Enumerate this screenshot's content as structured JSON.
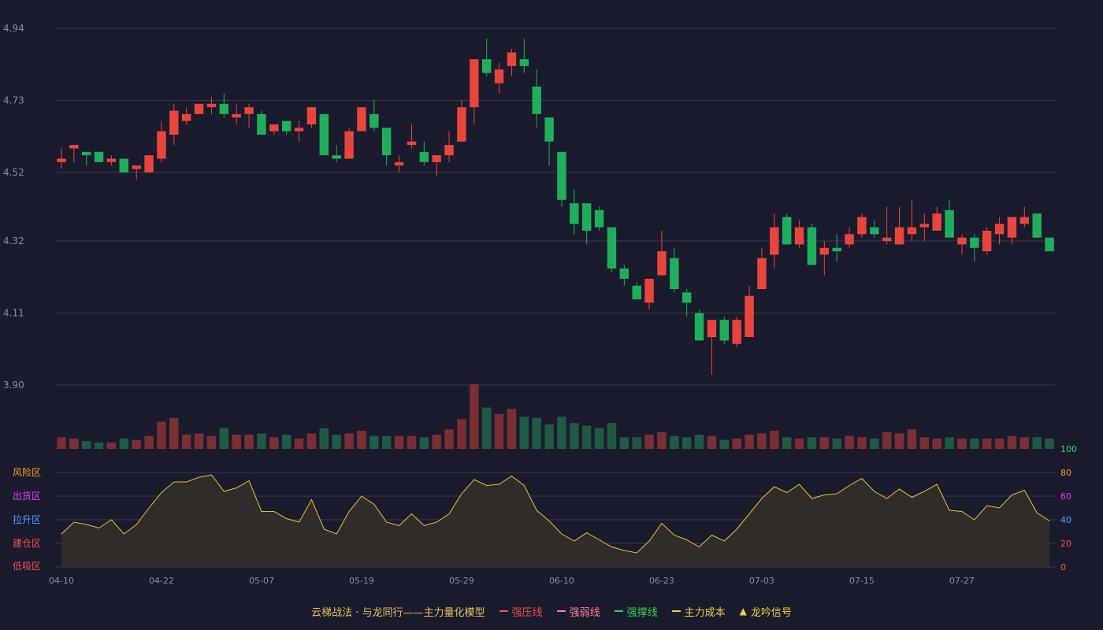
{
  "chart_data": {
    "type": "candlestick",
    "price_axis": {
      "ticks": [
        3.9,
        4.11,
        4.32,
        4.52,
        4.73,
        4.94
      ],
      "tick_labels": [
        "3.90",
        "4.11",
        "4.32",
        "4.52",
        "4.73",
        "4.94"
      ],
      "ylim": [
        3.9,
        4.94
      ]
    },
    "x_tick_labels": [
      "04-10",
      "04-22",
      "05-07",
      "05-19",
      "05-29",
      "06-10",
      "06-23",
      "07-03",
      "07-15",
      "07-27"
    ],
    "x_tick_indices": [
      0,
      8,
      16,
      24,
      32,
      40,
      48,
      56,
      64,
      72
    ],
    "candles": [
      [
        4.55,
        4.56,
        4.59,
        4.53
      ],
      [
        4.59,
        4.6,
        4.6,
        4.55
      ],
      [
        4.58,
        4.57,
        4.58,
        4.54
      ],
      [
        4.58,
        4.55,
        4.58,
        4.55
      ],
      [
        4.55,
        4.56,
        4.57,
        4.54
      ],
      [
        4.56,
        4.52,
        4.56,
        4.52
      ],
      [
        4.53,
        4.54,
        4.54,
        4.5
      ],
      [
        4.52,
        4.57,
        4.57,
        4.52
      ],
      [
        4.56,
        4.64,
        4.67,
        4.55
      ],
      [
        4.63,
        4.7,
        4.72,
        4.6
      ],
      [
        4.67,
        4.69,
        4.71,
        4.66
      ],
      [
        4.69,
        4.72,
        4.72,
        4.69
      ],
      [
        4.71,
        4.72,
        4.74,
        4.69
      ],
      [
        4.72,
        4.69,
        4.75,
        4.68
      ],
      [
        4.68,
        4.69,
        4.72,
        4.66
      ],
      [
        4.69,
        4.71,
        4.72,
        4.65
      ],
      [
        4.69,
        4.63,
        4.7,
        4.63
      ],
      [
        4.64,
        4.66,
        4.66,
        4.63
      ],
      [
        4.67,
        4.64,
        4.67,
        4.63
      ],
      [
        4.64,
        4.65,
        4.67,
        4.61
      ],
      [
        4.66,
        4.71,
        4.71,
        4.65
      ],
      [
        4.69,
        4.57,
        4.69,
        4.57
      ],
      [
        4.57,
        4.56,
        4.6,
        4.55
      ],
      [
        4.56,
        4.64,
        4.65,
        4.56
      ],
      [
        4.64,
        4.71,
        4.71,
        4.64
      ],
      [
        4.69,
        4.65,
        4.73,
        4.64
      ],
      [
        4.65,
        4.57,
        4.65,
        4.54
      ],
      [
        4.54,
        4.55,
        4.57,
        4.52
      ],
      [
        4.6,
        4.61,
        4.66,
        4.59
      ],
      [
        4.58,
        4.55,
        4.61,
        4.54
      ],
      [
        4.55,
        4.57,
        4.57,
        4.51
      ],
      [
        4.57,
        4.6,
        4.64,
        4.55
      ],
      [
        4.61,
        4.71,
        4.73,
        4.61
      ],
      [
        4.71,
        4.85,
        4.85,
        4.66
      ],
      [
        4.85,
        4.81,
        4.91,
        4.8
      ],
      [
        4.78,
        4.82,
        4.84,
        4.75
      ],
      [
        4.83,
        4.87,
        4.88,
        4.8
      ],
      [
        4.85,
        4.83,
        4.91,
        4.81
      ],
      [
        4.77,
        4.69,
        4.82,
        4.65
      ],
      [
        4.68,
        4.61,
        4.68,
        4.54
      ],
      [
        4.58,
        4.44,
        4.58,
        4.42
      ],
      [
        4.43,
        4.37,
        4.47,
        4.34
      ],
      [
        4.43,
        4.35,
        4.43,
        4.31
      ],
      [
        4.41,
        4.36,
        4.42,
        4.35
      ],
      [
        4.36,
        4.24,
        4.36,
        4.23
      ],
      [
        4.24,
        4.21,
        4.25,
        4.19
      ],
      [
        4.19,
        4.15,
        4.2,
        4.15
      ],
      [
        4.14,
        4.21,
        4.21,
        4.12
      ],
      [
        4.22,
        4.29,
        4.35,
        4.22
      ],
      [
        4.27,
        4.18,
        4.3,
        4.17
      ],
      [
        4.17,
        4.14,
        4.18,
        4.1
      ],
      [
        4.11,
        4.03,
        4.12,
        4.03
      ],
      [
        4.04,
        4.09,
        4.09,
        3.93
      ],
      [
        4.09,
        4.03,
        4.1,
        4.02
      ],
      [
        4.02,
        4.09,
        4.1,
        4.01
      ],
      [
        4.04,
        4.16,
        4.19,
        4.04
      ],
      [
        4.18,
        4.27,
        4.3,
        4.18
      ],
      [
        4.28,
        4.36,
        4.4,
        4.24
      ],
      [
        4.39,
        4.31,
        4.4,
        4.31
      ],
      [
        4.31,
        4.36,
        4.38,
        4.3
      ],
      [
        4.36,
        4.25,
        4.37,
        4.25
      ],
      [
        4.28,
        4.3,
        4.32,
        4.22
      ],
      [
        4.3,
        4.29,
        4.34,
        4.26
      ],
      [
        4.31,
        4.34,
        4.36,
        4.3
      ],
      [
        4.34,
        4.39,
        4.4,
        4.33
      ],
      [
        4.36,
        4.34,
        4.38,
        4.33
      ],
      [
        4.32,
        4.33,
        4.42,
        4.31
      ],
      [
        4.31,
        4.36,
        4.42,
        4.31
      ],
      [
        4.34,
        4.36,
        4.44,
        4.32
      ],
      [
        4.36,
        4.37,
        4.4,
        4.32
      ],
      [
        4.35,
        4.4,
        4.42,
        4.35
      ],
      [
        4.41,
        4.33,
        4.44,
        4.33
      ],
      [
        4.31,
        4.33,
        4.34,
        4.28
      ],
      [
        4.33,
        4.3,
        4.34,
        4.26
      ],
      [
        4.29,
        4.35,
        4.36,
        4.28
      ],
      [
        4.34,
        4.37,
        4.39,
        4.31
      ],
      [
        4.33,
        4.39,
        4.39,
        4.31
      ],
      [
        4.37,
        4.39,
        4.42,
        4.36
      ],
      [
        4.4,
        4.33,
        4.4,
        4.33
      ],
      [
        4.33,
        4.29,
        4.33,
        4.29
      ]
    ],
    "volume": [
      9,
      8,
      6,
      5,
      5,
      8,
      7,
      10,
      21,
      24,
      11,
      12,
      10,
      16,
      11,
      11,
      12,
      9,
      11,
      8,
      12,
      16,
      11,
      12,
      14,
      10,
      10,
      10,
      10,
      9,
      11,
      15,
      23,
      50,
      32,
      27,
      31,
      25,
      24,
      19,
      25,
      20,
      18,
      16,
      20,
      9,
      9,
      11,
      13,
      10,
      9,
      11,
      10,
      7,
      8,
      11,
      12,
      14,
      9,
      8,
      9,
      9,
      8,
      10,
      9,
      8,
      13,
      12,
      15,
      9,
      8,
      9,
      8,
      8,
      8,
      8,
      10,
      9,
      9,
      8
    ],
    "oscillator": {
      "axis_ticks": [
        0,
        20,
        40,
        60,
        80,
        100
      ],
      "axis_tick_labels": [
        "0",
        "20",
        "40",
        "60",
        "80",
        "100"
      ],
      "axis_tick_colors": [
        "#ef4f4f",
        "#ef4f4f",
        "#4f9dff",
        "#e040fb",
        "#f0a020",
        "#35d05a"
      ],
      "zone_labels": [
        "风险区",
        "出货区",
        "拉升区",
        "建仓区",
        "低吸区"
      ],
      "zone_colors": [
        "#f0a020",
        "#e040fb",
        "#4f9dff",
        "#ef4f4f",
        "#ef4f4f"
      ],
      "values": [
        28,
        38,
        36,
        33,
        40,
        28,
        36,
        50,
        63,
        72,
        72,
        76,
        78,
        64,
        67,
        73,
        47,
        47,
        41,
        38,
        57,
        32,
        28,
        47,
        60,
        53,
        38,
        35,
        45,
        35,
        38,
        45,
        62,
        74,
        69,
        70,
        77,
        69,
        48,
        39,
        28,
        22,
        29,
        23,
        17,
        14,
        12,
        22,
        37,
        27,
        23,
        17,
        27,
        22,
        32,
        45,
        58,
        68,
        63,
        70,
        58,
        61,
        62,
        69,
        75,
        64,
        58,
        66,
        59,
        64,
        70,
        48,
        47,
        40,
        52,
        50,
        61,
        65,
        46,
        39
      ]
    },
    "legend": {
      "title": "云梯战法 · 与龙同行——主力量化模型",
      "items": [
        {
          "label": "强压线",
          "color": "#ef4f4f",
          "style": "solid"
        },
        {
          "label": "强弱线",
          "color": "#ff7f9f",
          "style": "dashed"
        },
        {
          "label": "强撑线",
          "color": "#35d05a",
          "style": "solid"
        },
        {
          "label": "主力成本",
          "color": "#f0d040",
          "style": "dashed"
        },
        {
          "label": "龙吟信号",
          "color": "#f0d040",
          "style": "triangle"
        }
      ]
    },
    "colors": {
      "up": "#e8453c",
      "down": "#1fae5c",
      "up_volume": "#7a2f34",
      "down_volume": "#1f5a44",
      "oscillator_line": "#e0c030",
      "oscillator_fill": "#332f2a",
      "grid": "#3a3a4c",
      "axis_label": "#8a8a99",
      "legend_title": "#e0c060"
    }
  }
}
